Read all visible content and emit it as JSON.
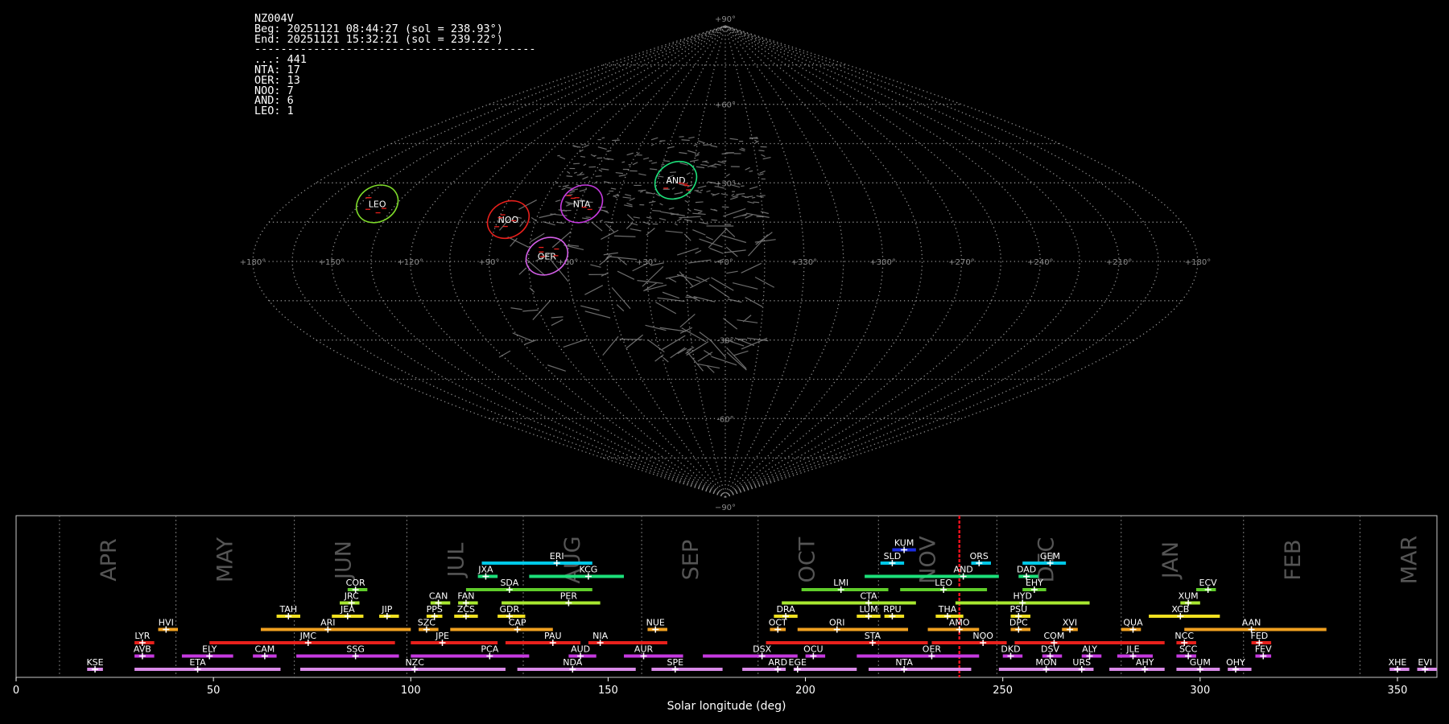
{
  "header": {
    "station": "NZ004V",
    "beg": "Beg: 20251121 08:44:27 (sol = 238.93°)",
    "end": "End: 20251121 15:32:21 (sol = 239.22°)",
    "separator": "-------------------------------------------",
    "counts": [
      {
        "label": "...: 441"
      },
      {
        "label": "NTA: 17"
      },
      {
        "label": "OER: 13"
      },
      {
        "label": "NOO: 7"
      },
      {
        "label": "AND: 6"
      },
      {
        "label": "LEO: 1"
      }
    ]
  },
  "sky_map": {
    "projection": "sinusoidal",
    "lon_ticks": [
      "+180°",
      "+150°",
      "+120°",
      "+90°",
      "+60°",
      "+30°",
      "+0°",
      "+330°",
      "+300°",
      "+270°",
      "+240°",
      "+210°",
      "+180°"
    ],
    "lat_ticks": [
      {
        "label": "+90°",
        "v": 90
      },
      {
        "label": "+60°",
        "v": 60
      },
      {
        "label": "+30°",
        "v": 30
      },
      {
        "label": "-30°",
        "v": -30
      },
      {
        "label": "-60°",
        "v": -60
      },
      {
        "label": "−90°",
        "v": -90
      }
    ],
    "radiants": [
      {
        "code": "LEO",
        "ex": -143,
        "ey": 22,
        "color": "#7fdc2a"
      },
      {
        "code": "NOO",
        "ex": -86,
        "ey": 16,
        "color": "#e8201c"
      },
      {
        "code": "NTA",
        "ex": -59,
        "ey": 22,
        "color": "#c63ae0"
      },
      {
        "code": "AND",
        "ex": -22,
        "ey": 31,
        "color": "#1ce07a"
      },
      {
        "code": "OER",
        "ex": -68,
        "ey": 2,
        "color": "#d35ee6"
      }
    ]
  },
  "chart_data": {
    "type": "timeline",
    "xlabel": "Solar longitude (deg)",
    "xlim": [
      0,
      360
    ],
    "x_ticks": [
      0,
      50,
      100,
      150,
      200,
      250,
      300,
      350
    ],
    "current_sol": 239,
    "months": [
      {
        "name": "APR",
        "start": 11
      },
      {
        "name": "MAY",
        "start": 40.5
      },
      {
        "name": "JUN",
        "start": 70.5
      },
      {
        "name": "JUL",
        "start": 99
      },
      {
        "name": "AUG",
        "start": 128.5
      },
      {
        "name": "SEP",
        "start": 158.5
      },
      {
        "name": "OCT",
        "start": 188
      },
      {
        "name": "NOV",
        "start": 218.5
      },
      {
        "name": "DEC",
        "start": 248.5
      },
      {
        "name": "JAN",
        "start": 280
      },
      {
        "name": "FEB",
        "start": 311
      },
      {
        "name": "MAR",
        "start": 340.5
      }
    ],
    "showers": [
      {
        "code": "KUM",
        "start": 222,
        "end": 228,
        "peak": 225,
        "row": 10,
        "color": "#1a2be0"
      },
      {
        "code": "ERI",
        "start": 118,
        "end": 146,
        "peak": 137,
        "row": 9,
        "color": "#00c8e8"
      },
      {
        "code": "SLD",
        "start": 219,
        "end": 225,
        "peak": 222,
        "row": 9,
        "color": "#00c8e8"
      },
      {
        "code": "ORS",
        "start": 242,
        "end": 247,
        "peak": 244,
        "row": 9,
        "color": "#00c8e8"
      },
      {
        "code": "GEM",
        "start": 255,
        "end": 266,
        "peak": 262,
        "row": 9,
        "color": "#00c8e8"
      },
      {
        "code": "JXA",
        "start": 117,
        "end": 122,
        "peak": 119,
        "row": 8,
        "color": "#1ce07a"
      },
      {
        "code": "KCG",
        "start": 130,
        "end": 154,
        "peak": 145,
        "row": 8,
        "color": "#1ce07a"
      },
      {
        "code": "AND",
        "start": 215,
        "end": 249,
        "peak": 240,
        "row": 8,
        "color": "#1ce07a"
      },
      {
        "code": "DAD",
        "start": 254,
        "end": 259,
        "peak": 256,
        "row": 8,
        "color": "#1ce07a"
      },
      {
        "code": "COR",
        "start": 84,
        "end": 89,
        "peak": 86,
        "row": 7,
        "color": "#5fcc2a"
      },
      {
        "code": "SDA",
        "start": 114,
        "end": 146,
        "peak": 125,
        "row": 7,
        "color": "#5fcc2a"
      },
      {
        "code": "LMI",
        "start": 199,
        "end": 221,
        "peak": 209,
        "row": 7,
        "color": "#5fcc2a"
      },
      {
        "code": "LEO",
        "start": 224,
        "end": 246,
        "peak": 235,
        "row": 7,
        "color": "#5fcc2a"
      },
      {
        "code": "EHY",
        "start": 255,
        "end": 261,
        "peak": 258,
        "row": 7,
        "color": "#5fcc2a"
      },
      {
        "code": "ECV",
        "start": 299,
        "end": 304,
        "peak": 302,
        "row": 7,
        "color": "#5fcc2a"
      },
      {
        "code": "JRC",
        "start": 82,
        "end": 87,
        "peak": 85,
        "row": 6,
        "color": "#a8e830"
      },
      {
        "code": "CAN",
        "start": 105,
        "end": 110,
        "peak": 107,
        "row": 6,
        "color": "#a8e830"
      },
      {
        "code": "FAN",
        "start": 112,
        "end": 117,
        "peak": 114,
        "row": 6,
        "color": "#a8e830"
      },
      {
        "code": "PER",
        "start": 123,
        "end": 148,
        "peak": 140,
        "row": 6,
        "color": "#a8e830"
      },
      {
        "code": "CTA",
        "start": 194,
        "end": 228,
        "peak": 216,
        "row": 6,
        "color": "#a8e830"
      },
      {
        "code": "HYD",
        "start": 238,
        "end": 272,
        "peak": 255,
        "row": 6,
        "color": "#a8e830"
      },
      {
        "code": "XUM",
        "start": 295,
        "end": 300,
        "peak": 297,
        "row": 6,
        "color": "#a8e830"
      },
      {
        "code": "TAH",
        "start": 66,
        "end": 72,
        "peak": 69,
        "row": 5,
        "color": "#f0e020"
      },
      {
        "code": "JEA",
        "start": 80,
        "end": 88,
        "peak": 84,
        "row": 5,
        "color": "#f0e020"
      },
      {
        "code": "JIP",
        "start": 92,
        "end": 97,
        "peak": 94,
        "row": 5,
        "color": "#f0e020"
      },
      {
        "code": "PPS",
        "start": 104,
        "end": 108,
        "peak": 106,
        "row": 5,
        "color": "#f0e020"
      },
      {
        "code": "ZCS",
        "start": 111,
        "end": 117,
        "peak": 114,
        "row": 5,
        "color": "#f0e020"
      },
      {
        "code": "GDR",
        "start": 122,
        "end": 129,
        "peak": 125,
        "row": 5,
        "color": "#f0e020"
      },
      {
        "code": "DRA",
        "start": 192,
        "end": 198,
        "peak": 195,
        "row": 5,
        "color": "#f0e020"
      },
      {
        "code": "LUM",
        "start": 213,
        "end": 219,
        "peak": 216,
        "row": 5,
        "color": "#f0e020"
      },
      {
        "code": "RPU",
        "start": 220,
        "end": 225,
        "peak": 222,
        "row": 5,
        "color": "#f0e020"
      },
      {
        "code": "THA",
        "start": 233,
        "end": 240,
        "peak": 236,
        "row": 5,
        "color": "#f0e020"
      },
      {
        "code": "PSU",
        "start": 252,
        "end": 257,
        "peak": 254,
        "row": 5,
        "color": "#f0e020"
      },
      {
        "code": "XCB",
        "start": 287,
        "end": 305,
        "peak": 295,
        "row": 5,
        "color": "#f0e020"
      },
      {
        "code": "HVI",
        "start": 36,
        "end": 41,
        "peak": 38,
        "row": 4,
        "color": "#f0a020"
      },
      {
        "code": "ARI",
        "start": 62,
        "end": 100,
        "peak": 79,
        "row": 4,
        "color": "#f0a020"
      },
      {
        "code": "SZC",
        "start": 102,
        "end": 107,
        "peak": 104,
        "row": 4,
        "color": "#f0a020"
      },
      {
        "code": "CAP",
        "start": 110,
        "end": 136,
        "peak": 127,
        "row": 4,
        "color": "#f0a020"
      },
      {
        "code": "NUE",
        "start": 160,
        "end": 165,
        "peak": 162,
        "row": 4,
        "color": "#f0a020"
      },
      {
        "code": "OCT",
        "start": 191,
        "end": 195,
        "peak": 193,
        "row": 4,
        "color": "#f0a020"
      },
      {
        "code": "ORI",
        "start": 198,
        "end": 226,
        "peak": 208,
        "row": 4,
        "color": "#f0a020"
      },
      {
        "code": "AMO",
        "start": 231,
        "end": 244,
        "peak": 239,
        "row": 4,
        "color": "#f0a020"
      },
      {
        "code": "DPC",
        "start": 252,
        "end": 257,
        "peak": 254,
        "row": 4,
        "color": "#f0a020"
      },
      {
        "code": "XVI",
        "start": 265,
        "end": 269,
        "peak": 267,
        "row": 4,
        "color": "#f0a020"
      },
      {
        "code": "QUA",
        "start": 280,
        "end": 285,
        "peak": 283,
        "row": 4,
        "color": "#f0a020"
      },
      {
        "code": "AAN",
        "start": 296,
        "end": 332,
        "peak": 313,
        "row": 4,
        "color": "#f0a020"
      },
      {
        "code": "LYR",
        "start": 30,
        "end": 35,
        "peak": 32,
        "row": 3,
        "color": "#e8201c"
      },
      {
        "code": "JMC",
        "start": 49,
        "end": 96,
        "peak": 74,
        "row": 3,
        "color": "#e8201c"
      },
      {
        "code": "JPE",
        "start": 100,
        "end": 122,
        "peak": 108,
        "row": 3,
        "color": "#e8201c"
      },
      {
        "code": "PAU",
        "start": 124,
        "end": 143,
        "peak": 136,
        "row": 3,
        "color": "#e8201c"
      },
      {
        "code": "NIA",
        "start": 145,
        "end": 165,
        "peak": 148,
        "row": 3,
        "color": "#e8201c"
      },
      {
        "code": "STA",
        "start": 190,
        "end": 231,
        "peak": 217,
        "row": 3,
        "color": "#e8201c"
      },
      {
        "code": "NOO",
        "start": 232,
        "end": 251,
        "peak": 245,
        "row": 3,
        "color": "#e8201c"
      },
      {
        "code": "COM",
        "start": 253,
        "end": 291,
        "peak": 263,
        "row": 3,
        "color": "#e8201c"
      },
      {
        "code": "NCC",
        "start": 294,
        "end": 299,
        "peak": 296,
        "row": 3,
        "color": "#e8201c"
      },
      {
        "code": "FED",
        "start": 313,
        "end": 318,
        "peak": 315,
        "row": 3,
        "color": "#e8201c"
      },
      {
        "code": "AVB",
        "start": 30,
        "end": 35,
        "peak": 32,
        "row": 2,
        "color": "#c63ae0"
      },
      {
        "code": "ELY",
        "start": 42,
        "end": 55,
        "peak": 49,
        "row": 2,
        "color": "#c63ae0"
      },
      {
        "code": "CAM",
        "start": 60,
        "end": 66,
        "peak": 63,
        "row": 2,
        "color": "#c63ae0"
      },
      {
        "code": "SSG",
        "start": 71,
        "end": 97,
        "peak": 86,
        "row": 2,
        "color": "#c63ae0"
      },
      {
        "code": "PCA",
        "start": 100,
        "end": 130,
        "peak": 120,
        "row": 2,
        "color": "#c63ae0"
      },
      {
        "code": "AUD",
        "start": 140,
        "end": 147,
        "peak": 143,
        "row": 2,
        "color": "#c63ae0"
      },
      {
        "code": "AUR",
        "start": 154,
        "end": 169,
        "peak": 159,
        "row": 2,
        "color": "#c63ae0"
      },
      {
        "code": "DSX",
        "start": 174,
        "end": 198,
        "peak": 189,
        "row": 2,
        "color": "#c63ae0"
      },
      {
        "code": "OCU",
        "start": 200,
        "end": 205,
        "peak": 202,
        "row": 2,
        "color": "#c63ae0"
      },
      {
        "code": "OER",
        "start": 213,
        "end": 244,
        "peak": 232,
        "row": 2,
        "color": "#c63ae0"
      },
      {
        "code": "DKD",
        "start": 250,
        "end": 255,
        "peak": 252,
        "row": 2,
        "color": "#c63ae0"
      },
      {
        "code": "DSV",
        "start": 260,
        "end": 265,
        "peak": 262,
        "row": 2,
        "color": "#c63ae0"
      },
      {
        "code": "ALY",
        "start": 270,
        "end": 275,
        "peak": 272,
        "row": 2,
        "color": "#c63ae0"
      },
      {
        "code": "JLE",
        "start": 279,
        "end": 288,
        "peak": 283,
        "row": 2,
        "color": "#c63ae0"
      },
      {
        "code": "SCC",
        "start": 294,
        "end": 299,
        "peak": 297,
        "row": 2,
        "color": "#c63ae0"
      },
      {
        "code": "FEV",
        "start": 314,
        "end": 318,
        "peak": 316,
        "row": 2,
        "color": "#c63ae0"
      },
      {
        "code": "KSE",
        "start": 18,
        "end": 22,
        "peak": 20,
        "row": 1,
        "color": "#d98ae8"
      },
      {
        "code": "ETA",
        "start": 30,
        "end": 67,
        "peak": 46,
        "row": 1,
        "color": "#d98ae8"
      },
      {
        "code": "NZC",
        "start": 72,
        "end": 124,
        "peak": 101,
        "row": 1,
        "color": "#d98ae8"
      },
      {
        "code": "NDA",
        "start": 127,
        "end": 157,
        "peak": 141,
        "row": 1,
        "color": "#d98ae8"
      },
      {
        "code": "SPE",
        "start": 161,
        "end": 179,
        "peak": 167,
        "row": 1,
        "color": "#d98ae8"
      },
      {
        "code": "ARD",
        "start": 184,
        "end": 195,
        "peak": 193,
        "row": 1,
        "color": "#d98ae8"
      },
      {
        "code": "EGE",
        "start": 197,
        "end": 213,
        "peak": 198,
        "row": 1,
        "color": "#d98ae8"
      },
      {
        "code": "NTA",
        "start": 216,
        "end": 242,
        "peak": 225,
        "row": 1,
        "color": "#d98ae8"
      },
      {
        "code": "MON",
        "start": 249,
        "end": 270,
        "peak": 261,
        "row": 1,
        "color": "#d98ae8"
      },
      {
        "code": "URS",
        "start": 268,
        "end": 273,
        "peak": 270,
        "row": 1,
        "color": "#d98ae8"
      },
      {
        "code": "AHY",
        "start": 277,
        "end": 291,
        "peak": 286,
        "row": 1,
        "color": "#d98ae8"
      },
      {
        "code": "GUM",
        "start": 294,
        "end": 305,
        "peak": 300,
        "row": 1,
        "color": "#d98ae8"
      },
      {
        "code": "OHY",
        "start": 307,
        "end": 313,
        "peak": 309,
        "row": 1,
        "color": "#d98ae8"
      },
      {
        "code": "XHE",
        "start": 348,
        "end": 353,
        "peak": 350,
        "row": 1,
        "color": "#d98ae8"
      },
      {
        "code": "EVI",
        "start": 355,
        "end": 360,
        "peak": 357,
        "row": 1,
        "color": "#d98ae8"
      }
    ]
  }
}
